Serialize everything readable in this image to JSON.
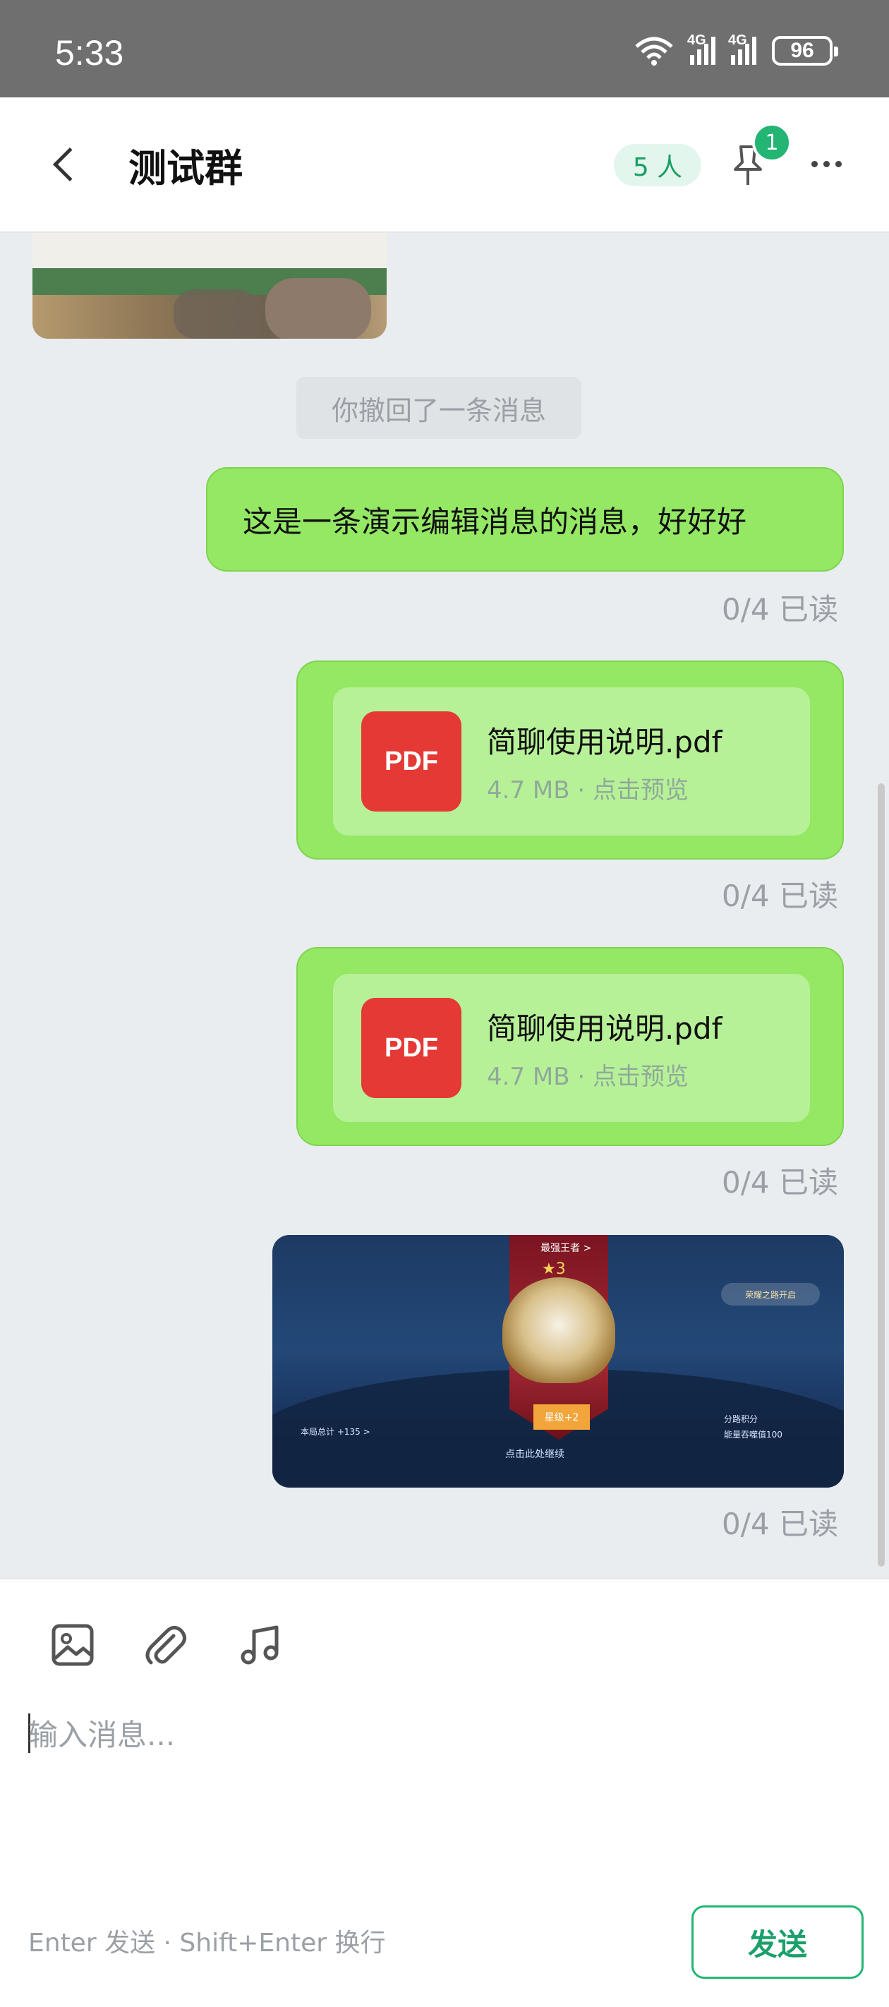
{
  "status_bar": {
    "time": "5:33",
    "wifi_tag": "6",
    "signal1_tag": "4G",
    "signal2_tag": "4G",
    "battery": "96"
  },
  "header": {
    "title": "测试群",
    "member_count": "5 人",
    "pin_badge": "1"
  },
  "messages": {
    "revoked_notice": "你撤回了一条消息",
    "text_message": "这是一条演示编辑消息的消息，好好好",
    "read_status": "0/4 已读",
    "files": [
      {
        "icon_label": "PDF",
        "name": "简聊使用说明.pdf",
        "meta": "4.7 MB · 点击预览"
      },
      {
        "icon_label": "PDF",
        "name": "简聊使用说明.pdf",
        "meta": "4.7 MB · 点击预览"
      }
    ],
    "game_image": {
      "top_label": "最强王者 >",
      "stars": "★3",
      "rank_label": "星级+2",
      "continue_label": "点击此处继续",
      "left_label": "本局总计 +135 >",
      "right_pill": "荣耀之路开启",
      "right_text_1": "分路积分",
      "right_text_2": "能量吞噬值100"
    }
  },
  "composer": {
    "placeholder": "输入消息...",
    "hint": "Enter 发送 · Shift+Enter 换行",
    "send_label": "发送"
  },
  "colors": {
    "bubble_green": "#94e864",
    "accent_green": "#22b573",
    "chat_bg": "#e9edf0"
  }
}
